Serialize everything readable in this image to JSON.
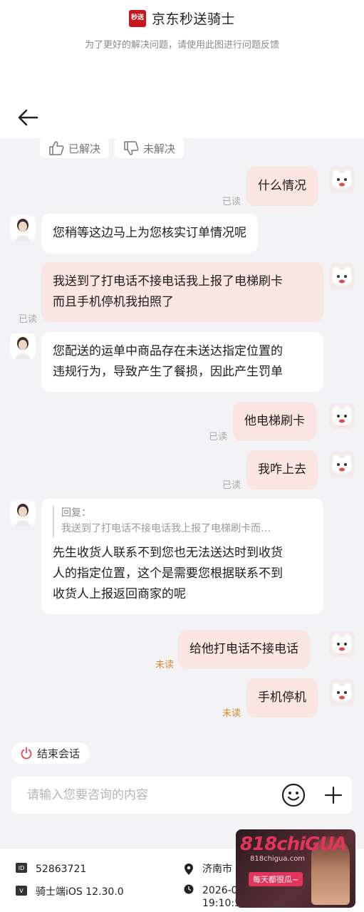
{
  "header": {
    "brand_logo_text": "秒送",
    "brand_title": "京东秒送骑士",
    "subtitle": "为了更好的解决问题，请使用此图进行问题反馈"
  },
  "topbar": {
    "back_icon": "arrow-left-icon"
  },
  "feedback": {
    "resolved": "已解决",
    "unresolved": "未解决"
  },
  "messages": [
    {
      "side": "out",
      "text": "什么情况",
      "status": "已读"
    },
    {
      "side": "in",
      "text": "您稍等这边马上为您核实订单情况呢"
    },
    {
      "side": "out",
      "line1": "我送到了打电话不接电话我上报了电梯刷卡",
      "line2": "而且手机停机我拍照了",
      "status": "已读"
    },
    {
      "side": "in",
      "line1": "您配送的运单中商品存在未送达指定位置的",
      "line2": "违规行为，导致产生了餐损，因此产生罚单"
    },
    {
      "side": "out",
      "text": "他电梯刷卡",
      "status": "已读"
    },
    {
      "side": "out",
      "text": "我咋上去",
      "status": "已读"
    },
    {
      "side": "in",
      "reply_label": "回复：",
      "reply_text": "我送到了打电话不接电话我上报了电梯刷卡而…",
      "line1": "先生收货人联系不到您也无法送达时到收货",
      "line2": "人的指定位置，这个是需要您根据联系不到",
      "line3": "收货人上报返回商家的呢"
    },
    {
      "side": "out",
      "text": "给他打电话不接电话",
      "status": "未读"
    },
    {
      "side": "out",
      "text": "手机停机",
      "status": "未读"
    }
  ],
  "end_session": {
    "label": "结束会话"
  },
  "input": {
    "placeholder": "请输入您要咨询的内容"
  },
  "footer": {
    "id_label": "ID",
    "id_value": "52863721",
    "version_label": "V",
    "version_value": "骑士端iOS  12.30.0",
    "city": "济南市",
    "date": "2026-08-17",
    "time": "19:10:59"
  },
  "watermark": {
    "title": "818chiGUA",
    "site": "818chigua.com",
    "tagline": "每天都很瓜~"
  },
  "colors": {
    "outgoing_bubble": "#fbe5e0",
    "incoming_bubble": "#ffffff",
    "unread": "#d98a2c",
    "brand": "#c8161d"
  }
}
